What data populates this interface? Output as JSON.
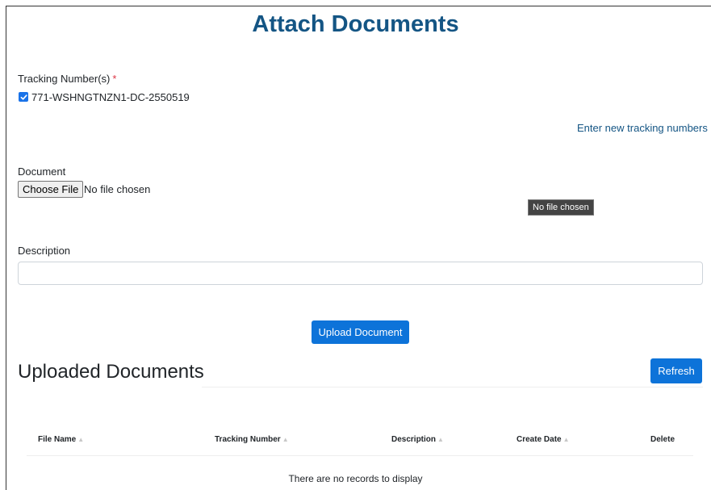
{
  "page": {
    "title": "Attach Documents"
  },
  "tracking": {
    "label": "Tracking Number(s)",
    "required_mark": "*",
    "items": [
      {
        "number": "771-WSHNGTNZN1-DC-2550519",
        "checked": true
      }
    ],
    "new_link": "Enter new tracking numbers"
  },
  "document": {
    "label": "Document",
    "choose_button": "Choose File",
    "status": "No file chosen",
    "tooltip": "No file chosen"
  },
  "description": {
    "label": "Description",
    "value": "",
    "placeholder": ""
  },
  "upload_button": "Upload Document",
  "uploaded": {
    "title": "Uploaded Documents",
    "refresh_button": "Refresh",
    "columns": [
      "File Name",
      "Tracking Number",
      "Description",
      "Create Date",
      "Delete"
    ],
    "sort_glyph": "▲",
    "rows": [],
    "empty_message": "There are no records to display"
  },
  "colors": {
    "title": "#145584",
    "primary": "#0d73d9",
    "link": "#145584",
    "required": "#dc3545"
  }
}
